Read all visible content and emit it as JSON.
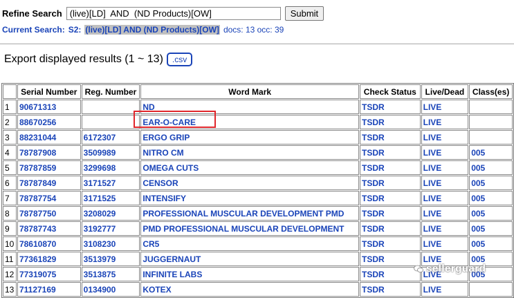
{
  "search": {
    "label": "Refine Search",
    "value": "(live)[LD]  AND  (ND Products)[OW]",
    "submit_label": "Submit"
  },
  "current": {
    "label": "Current Search:",
    "set": "S2:",
    "query": "(live)[LD] AND (ND Products)[OW]",
    "stats": "docs: 13 occ: 39"
  },
  "export": {
    "text": "Export displayed results (1 ~ 13)",
    "csv_label": ".csv"
  },
  "table": {
    "headers": [
      "",
      "Serial Number",
      "Reg. Number",
      "Word Mark",
      "Check Status",
      "Live/Dead",
      "Class(es)"
    ],
    "rows": [
      {
        "n": "1",
        "serial": "90671313",
        "reg": "",
        "mark": "ND",
        "status": "TSDR",
        "live": "LIVE",
        "cls": ""
      },
      {
        "n": "2",
        "serial": "88670256",
        "reg": "",
        "mark": "EAR-O-CARE",
        "status": "TSDR",
        "live": "LIVE",
        "cls": ""
      },
      {
        "n": "3",
        "serial": "88231044",
        "reg": "6172307",
        "mark": "ERGO GRIP",
        "status": "TSDR",
        "live": "LIVE",
        "cls": ""
      },
      {
        "n": "4",
        "serial": "78787908",
        "reg": "3509989",
        "mark": "NITRO CM",
        "status": "TSDR",
        "live": "LIVE",
        "cls": "005"
      },
      {
        "n": "5",
        "serial": "78787859",
        "reg": "3299698",
        "mark": "OMEGA CUTS",
        "status": "TSDR",
        "live": "LIVE",
        "cls": "005"
      },
      {
        "n": "6",
        "serial": "78787849",
        "reg": "3171527",
        "mark": "CENSOR",
        "status": "TSDR",
        "live": "LIVE",
        "cls": "005"
      },
      {
        "n": "7",
        "serial": "78787754",
        "reg": "3171525",
        "mark": "INTENSIFY",
        "status": "TSDR",
        "live": "LIVE",
        "cls": "005"
      },
      {
        "n": "8",
        "serial": "78787750",
        "reg": "3208029",
        "mark": "PROFESSIONAL MUSCULAR DEVELOPMENT PMD",
        "status": "TSDR",
        "live": "LIVE",
        "cls": "005"
      },
      {
        "n": "9",
        "serial": "78787743",
        "reg": "3192777",
        "mark": "PMD PROFESSIONAL MUSCULAR DEVELOPMENT",
        "status": "TSDR",
        "live": "LIVE",
        "cls": "005"
      },
      {
        "n": "10",
        "serial": "78610870",
        "reg": "3108230",
        "mark": "CR5",
        "status": "TSDR",
        "live": "LIVE",
        "cls": "005"
      },
      {
        "n": "11",
        "serial": "77361829",
        "reg": "3513979",
        "mark": "JUGGERNAUT",
        "status": "TSDR",
        "live": "LIVE",
        "cls": "005"
      },
      {
        "n": "12",
        "serial": "77319075",
        "reg": "3513875",
        "mark": "INFINITE LABS",
        "status": "TSDR",
        "live": "LIVE",
        "cls": "005"
      },
      {
        "n": "13",
        "serial": "71127169",
        "reg": "0134900",
        "mark": "KOTEX",
        "status": "TSDR",
        "live": "LIVE",
        "cls": ""
      }
    ]
  },
  "watermark": {
    "text": "sellerguard",
    "icon": "wechat-icon"
  },
  "colors": {
    "link": "#1a44b8",
    "highlight_box": "#e0262b"
  }
}
